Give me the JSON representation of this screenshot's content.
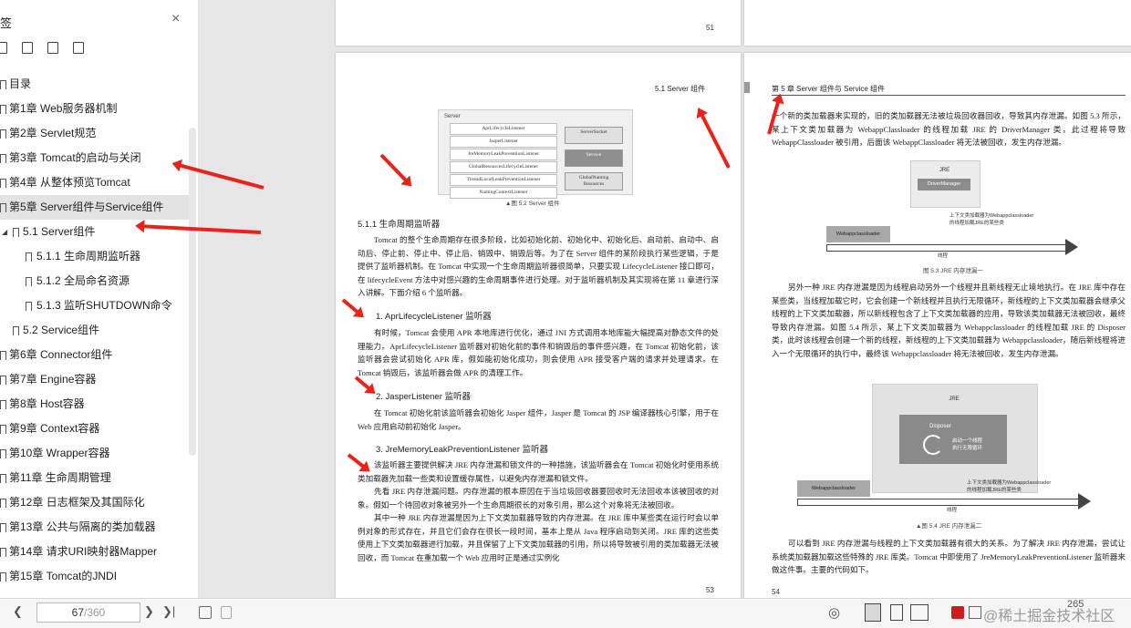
{
  "sidebar": {
    "title": "签",
    "close": "×",
    "items": [
      {
        "label": "目录"
      },
      {
        "label": "第1章 Web服务器机制"
      },
      {
        "label": "第2章 Servlet规范"
      },
      {
        "label": "第3章 Tomcat的启动与关闭"
      },
      {
        "label": "第4章 从整体预览Tomcat"
      },
      {
        "label": "第5章 Server组件与Service组件"
      },
      {
        "label": "5.1 Server组件"
      },
      {
        "label": "5.1.1 生命周期监听器"
      },
      {
        "label": "5.1.2 全局命名资源"
      },
      {
        "label": "5.1.3 监听SHUTDOWN命令"
      },
      {
        "label": "5.2 Service组件"
      },
      {
        "label": "第6章 Connector组件"
      },
      {
        "label": "第7章 Engine容器"
      },
      {
        "label": "第8章 Host容器"
      },
      {
        "label": "第9章 Context容器"
      },
      {
        "label": "第10章 Wrapper容器"
      },
      {
        "label": "第11章 生命周期管理"
      },
      {
        "label": "第12章 日志框架及其国际化"
      },
      {
        "label": "第13章 公共与隔离的类加载器"
      },
      {
        "label": "第14章 请求URI映射器Mapper"
      },
      {
        "label": "第15章 Tomcat的JNDI"
      }
    ]
  },
  "pages": {
    "top_left_num": "51",
    "left_num": "53",
    "right_num": "54",
    "left_header": "5.1   Server 组件",
    "right_header": "第 5 章   Server 组件与 Service 组件",
    "fig52": {
      "title": "Server",
      "listeners": [
        "AprLifecycleListener",
        "JasperListener",
        "JreMemoryLeakPreventionListener",
        "GlobalResourcesLifecycleListener",
        "ThreadLocalLeakPreventionListener",
        "NamingContextListener"
      ],
      "right_boxes": [
        "ServerSocket",
        "Service",
        "GlobalNaming\nResources"
      ],
      "caption": "▲图 5.2   Server 组件"
    },
    "sec511": "5.1.1   生命周期监听器",
    "p1": "Tomcat 的整个生命周期存在很多阶段，比如初始化前、初始化中、初始化后、启动前、启动中、启动后、停止前、停止中、停止后、销毁中、销毁后等。为了在 Server 组件的某阶段执行某些逻辑，于是提供了监听器机制。在 Tomcat 中实现一个生命周期监听器很简单，只要实现 LifecycleListener 接口即可，在 lifecycleEvent 方法中对感兴趣的生命周期事件进行处理。对于监听器机制及其实现将在第 11 章进行深入讲解。下面介绍 6 个监听器。",
    "h1": "1.   AprLifecycleListener 监听器",
    "p2": "有时候，Tomcat 会使用 APR 本地库进行优化，通过 JNI 方式调用本地库能大幅提高对静态文件的处理能力。AprLifecycleListener 监听器对初始化前的事件和销毁后的事件感兴趣，在 Tomcat 初始化前，该监听器会尝试初始化 APR 库，假如能初始化成功，则会使用 APR 接受客户端的请求并处理请求。在 Tomcat 销毁后，该监听器会做 APR 的清理工作。",
    "h2": "2.   JasperListener 监听器",
    "p3": "在 Tomcat 初始化前该监听器会初始化 Jasper 组件，Jasper 是 Tomcat 的 JSP 编译器核心引擎，用于在 Web 应用启动前初始化 Jasper。",
    "h3": "3.   JreMemoryLeakPreventionListener 监听器",
    "p4": "该监听器主要提供解决 JRE 内存泄漏和锁文件的一种措施，该监听器会在 Tomcat 初始化时使用系统类加载器先加载一些类和设置缓存属性，以避免内存泄漏和锁文件。",
    "p5": "先看 JRE 内存泄漏问题。内存泄漏的根本原因在于当垃圾回收器要回收时无法回收本该被回收的对象。假如一个待回收对象被另外一个生命周期很长的对象引用，那么这个对象将无法被回收。",
    "p6": "其中一种 JRE 内存泄漏是因为上下文类加载器导致的内存泄漏。在 JRE 库中某些类在运行时会以单例对象的形式存在，并且它们会存在很长一段时间，基本上是从 Java 程序启动到关闭。JRE 库的这些类使用上下文类加载器进行加载，并且保留了上下文类加载器的引用，所以将导致被引用的类加载器无法被回收，而 Tomcat 在重加载一个 Web 应用时正是通过实例化",
    "rp1": "一个新的类加载器来实现的，旧的类加载器无法被垃圾回收器回收，导致其内存泄漏。如图 5.3 所示，某上下文类加载器为 WebappClassloader 的线程加载 JRE 的 DriverManager 类，此过程将导致 WebappClassloader 被引用，后面该 WebappClassloader 将无法被回收，发生内存泄漏。",
    "fig53": {
      "jre": "JRE",
      "dm": "DriverManager",
      "note": "上下文类加载器为Webappclassloader\n的线程加载JRE的某些类",
      "wc": "Webappclassloader",
      "thread": "线程",
      "caption": "图 5.3   JRE 内存泄漏一"
    },
    "rp2": "另外一种 JRE 内存泄漏是因为线程启动另外一个线程并且新线程无止境地执行。在 JRE 库中存在某些类，当线程加载它时，它会创建一个新线程并且执行无限循环，新线程的上下文类加载器会继承父线程的上下文类加载器，所以新线程包含了上下文类加载器的应用，导致该类加载器无法被回收，最终导致内存泄漏。如图 5.4 所示，某上下文类加载器为 Webappclassloader 的线程加载 JRE 的 Disposer 类，此时该线程会创建一个新的线程，新线程的上下文类加载器为 Webappclassloader，随后新线程将进入一个无限循环的执行中，最终该 Webappclassloader 将无法被回收，发生内存泄漏。",
    "fig54": {
      "jre": "JRE",
      "disposer": "Disposer",
      "start": "启动一个线程\n执行无限循环",
      "note": "上下文类加载器为Webappclassloader\n的线程加载JRE的某些类",
      "wc": "Webappclassloader",
      "thread": "线程",
      "caption": "▲图 5.4   JRE 内存泄漏二"
    },
    "rp3": "可以看到 JRE 内存泄漏与线程的上下文类加载器有很大的关系。为了解决 JRE 内存泄漏，尝试让系统类加载器加载这些特殊的 JRE 库类。Tomcat 中即使用了 JreMemoryLeakPreventionListener 监听器来做这件事。主要的代码如下。"
  },
  "bottom": {
    "current_page": "67",
    "total_pages": "/360",
    "zoom": "265",
    "watermark": "@稀土掘金技术社区"
  },
  "colors": {
    "arrow": "#e8231b",
    "selected": "#e3e3e3",
    "video_icon": "#cc1c1c"
  }
}
